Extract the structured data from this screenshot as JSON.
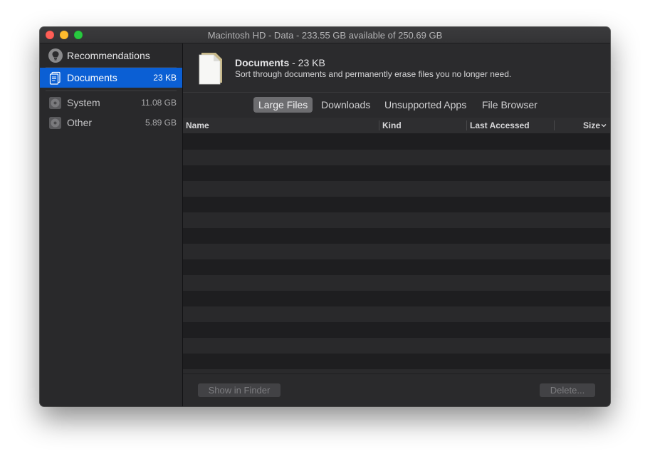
{
  "window": {
    "title": "Macintosh HD - Data - 233.55 GB available of 250.69 GB"
  },
  "sidebar": {
    "recommendations": {
      "label": "Recommendations",
      "icon": "lightbulb-icon"
    },
    "items": [
      {
        "label": "Documents",
        "size": "23 KB",
        "icon": "documents-icon",
        "selected": true
      },
      {
        "label": "System",
        "size": "11.08 GB",
        "icon": "disk-icon",
        "selected": false
      },
      {
        "label": "Other",
        "size": "5.89 GB",
        "icon": "disk-icon",
        "selected": false
      }
    ]
  },
  "header": {
    "title": "Documents",
    "title_suffix": " - 23 KB",
    "subtitle": "Sort through documents and permanently erase files you no longer need.",
    "icon": "document-icon"
  },
  "tabs": [
    {
      "label": "Large Files",
      "active": true
    },
    {
      "label": "Downloads",
      "active": false
    },
    {
      "label": "Unsupported Apps",
      "active": false
    },
    {
      "label": "File Browser",
      "active": false
    }
  ],
  "table": {
    "columns": [
      "Name",
      "Kind",
      "Last Accessed",
      "Size"
    ],
    "sort_column": "Size",
    "sort_indicator": "chevron-down-icon",
    "rows": []
  },
  "footer": {
    "show_in_finder": "Show in Finder",
    "delete": "Delete..."
  },
  "colors": {
    "accent": "#0b5fd4",
    "window_bg": "#2a2a2c",
    "row_dark": "#1e1e20",
    "row_light": "#29292b",
    "close": "#fe5f57",
    "minimize": "#febc2e",
    "zoom": "#28c840"
  }
}
